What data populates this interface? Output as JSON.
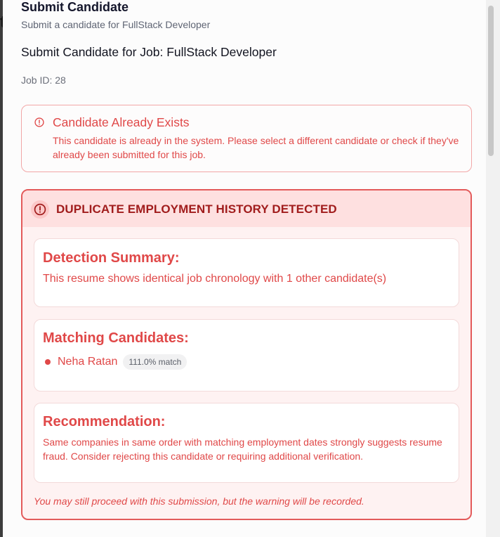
{
  "dialog": {
    "title": "Submit Candidate",
    "subtitle": "Submit a candidate for FullStack Developer",
    "job_heading": "Submit Candidate for Job: FullStack Developer",
    "job_id": "Job ID: 28"
  },
  "alert": {
    "icon": "alert-circle-icon",
    "title": "Candidate Already Exists",
    "message": "This candidate is already in the system. Please select a different candidate or check if they've already been submitted for this job."
  },
  "duplicate": {
    "icon": "alert-circle-icon",
    "title": "DUPLICATE EMPLOYMENT HISTORY DETECTED",
    "summary": {
      "heading": "Detection Summary:",
      "text": "This resume shows identical job chronology with 1 other candidate(s)"
    },
    "matching": {
      "heading": "Matching Candidates:",
      "candidates": [
        {
          "name": "Neha Ratan",
          "match": "111.0% match"
        }
      ]
    },
    "recommendation": {
      "heading": "Recommendation:",
      "text": "Same companies in same order with matching employment dates strongly suggests resume fraud. Consider rejecting this candidate or requiring additional verification."
    },
    "footnote": "You may still proceed with this submission, but the warning will be recorded."
  },
  "colors": {
    "error_text": "#e04848",
    "error_dark": "#a11d1d",
    "error_border": "#e35a5a",
    "error_bg": "#fef2f2"
  }
}
